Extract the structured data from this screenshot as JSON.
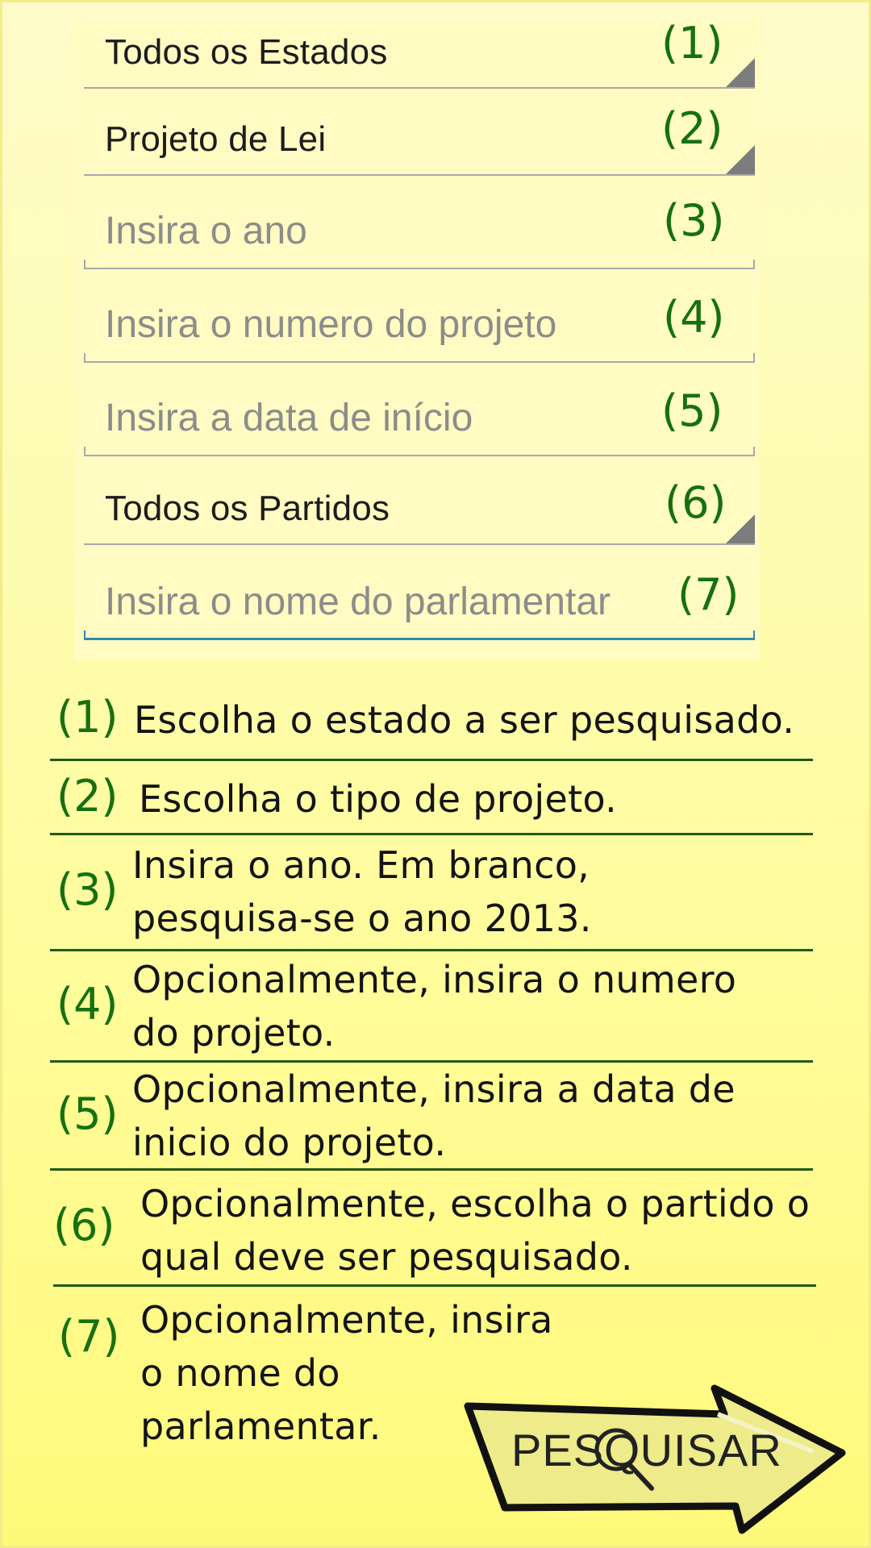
{
  "form": {
    "fields": [
      {
        "value": "Todos os Estados",
        "marker": "(1)"
      },
      {
        "value": "Projeto de Lei",
        "marker": "(2)"
      },
      {
        "placeholder": "Insira o ano",
        "marker": "(3)"
      },
      {
        "placeholder": "Insira o numero do projeto",
        "marker": "(4)"
      },
      {
        "placeholder": "Insira a data de início",
        "marker": "(5)"
      },
      {
        "value": "Todos os Partidos",
        "marker": "(6)"
      },
      {
        "placeholder": "Insira o nome do parlamentar",
        "marker": "(7)"
      }
    ]
  },
  "help": [
    {
      "num": "(1)",
      "text": "Escolha o estado a ser pesquisado."
    },
    {
      "num": "(2)",
      "text": "Escolha o tipo de projeto."
    },
    {
      "num": "(3)",
      "text": "Insira o ano. Em branco, pesquisa-se o ano 2013."
    },
    {
      "num": "(4)",
      "text": "Opcionalmente, insira o numero do projeto."
    },
    {
      "num": "(5)",
      "text": "Opcionalmente, insira a data de inicio do projeto."
    },
    {
      "num": "(6)",
      "text": "Opcionalmente, escolha o partido o qual deve ser pesquisado."
    },
    {
      "num": "(7)",
      "text": "Opcionalmente, insira o nome do parlamentar."
    }
  ],
  "search_button": {
    "label": "PESQUISAR"
  },
  "colors": {
    "marker_green": "#17700f",
    "divider_green": "#1f5a16",
    "focus_blue": "#2d8ab3"
  },
  "icons": [
    "dropdown-triangle-icon",
    "magnifier-icon",
    "arrow-icon"
  ]
}
